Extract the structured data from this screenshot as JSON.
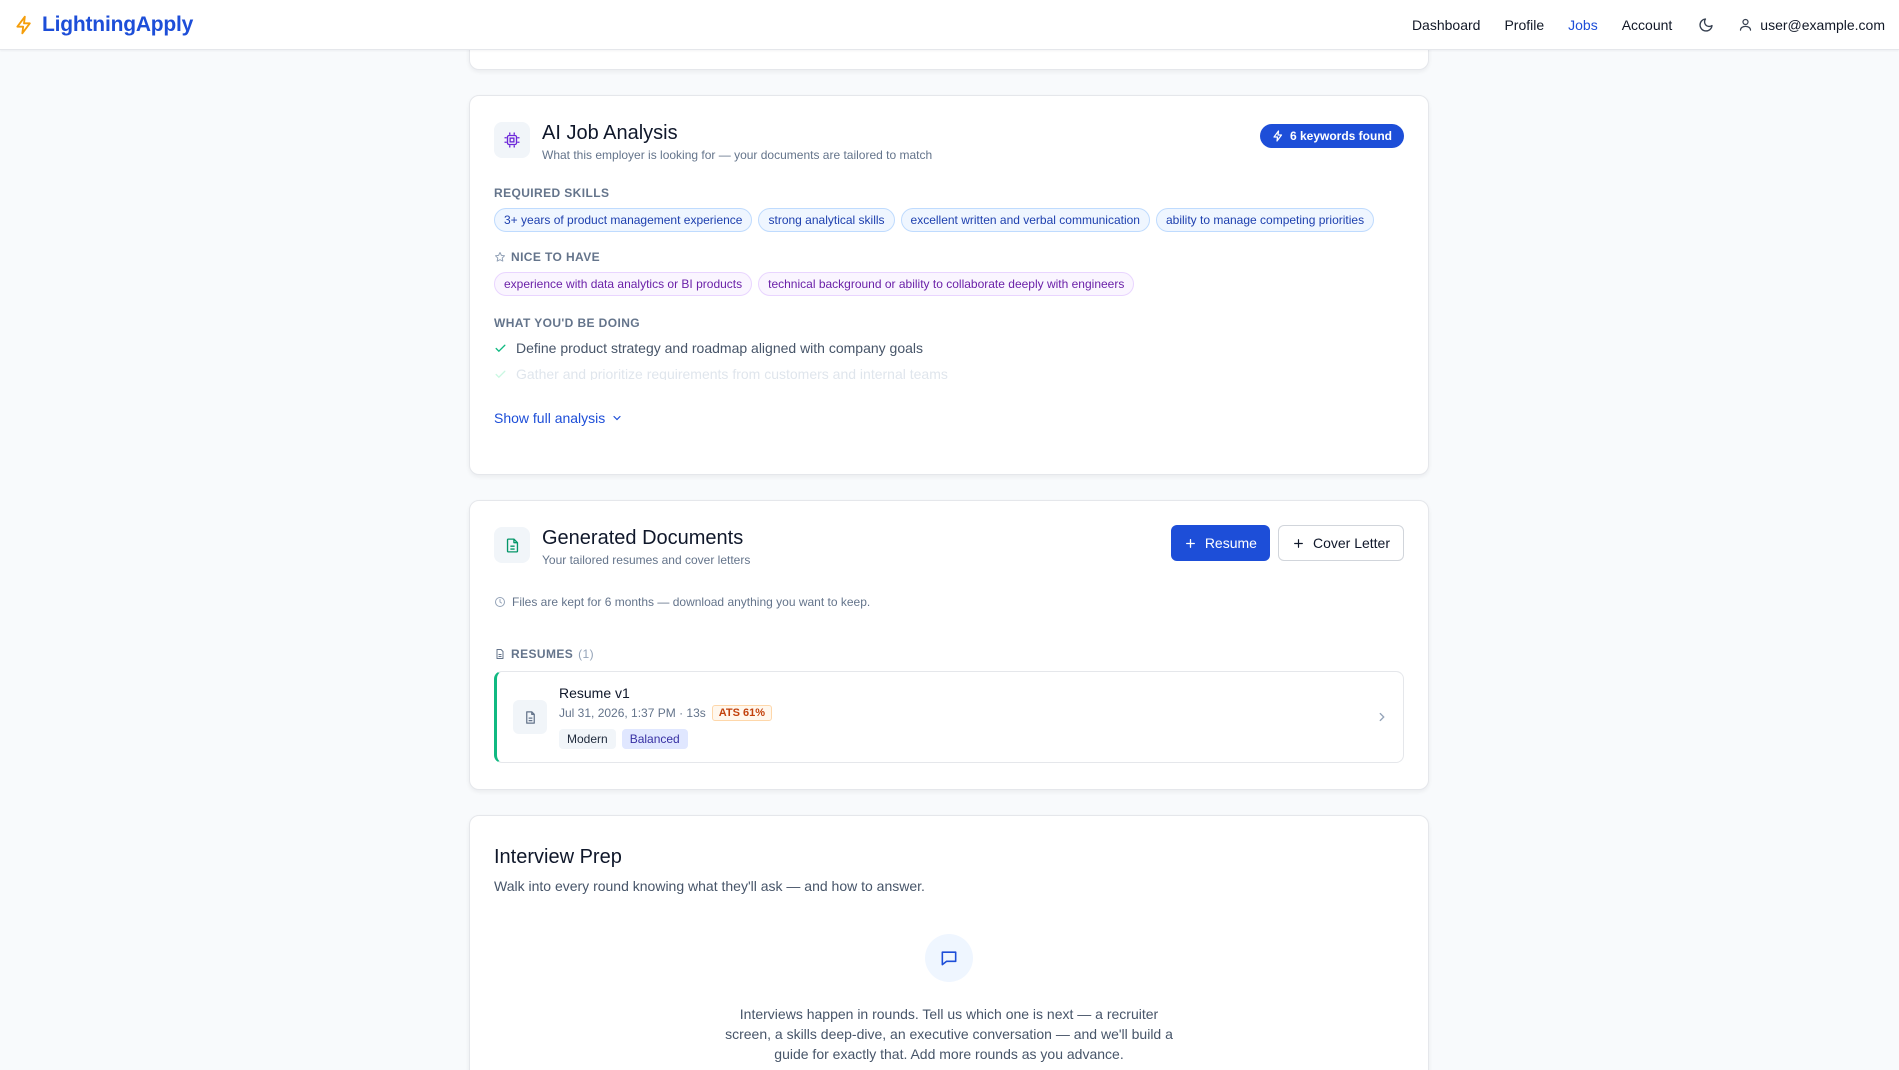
{
  "nav": {
    "brand": "LightningApply",
    "links": [
      {
        "label": "Dashboard",
        "active": false
      },
      {
        "label": "Profile",
        "active": false
      },
      {
        "label": "Jobs",
        "active": true
      },
      {
        "label": "Account",
        "active": false
      }
    ],
    "user_email": "user@example.com",
    "icons": {
      "brand": "lightning-bolt-icon",
      "theme": "moon-icon",
      "user": "user-icon"
    }
  },
  "analysis": {
    "title": "AI Job Analysis",
    "subtitle": "What this employer is looking for — your documents are tailored to match",
    "badge": "6 keywords found",
    "required_label": "REQUIRED SKILLS",
    "required": [
      "3+ years of product management experience",
      "strong analytical skills",
      "excellent written and verbal communication",
      "ability to manage competing priorities"
    ],
    "nice_label": "NICE TO HAVE",
    "nice": [
      "experience with data analytics or BI products",
      "technical background or ability to collaborate deeply with engineers"
    ],
    "doing_label": "WHAT YOU'D BE DOING",
    "doing": [
      "Define product strategy and roadmap aligned with company goals",
      "Gather and prioritize requirements from customers and internal teams"
    ],
    "show_more": "Show full analysis"
  },
  "documents": {
    "title": "Generated Documents",
    "subtitle": "Your tailored resumes and cover letters",
    "btn_resume": "Resume",
    "btn_cover": "Cover Letter",
    "note": "Files are kept for 6 months — download anything you want to keep.",
    "resumes_label": "RESUMES",
    "resumes_count": "(1)",
    "item": {
      "title": "Resume v1",
      "meta": "Jul 31, 2026, 1:37 PM · 13s",
      "ats": "ATS 61%",
      "tags": [
        "Modern",
        "Balanced"
      ]
    }
  },
  "interview": {
    "title": "Interview Prep",
    "subtitle": "Walk into every round knowing what they'll ask — and how to answer.",
    "body": "Interviews happen in rounds. Tell us which one is next — a recruiter screen, a skills deep-dive, an executive conversation — and we'll build a guide for exactly that. Add more rounds as you advance."
  }
}
